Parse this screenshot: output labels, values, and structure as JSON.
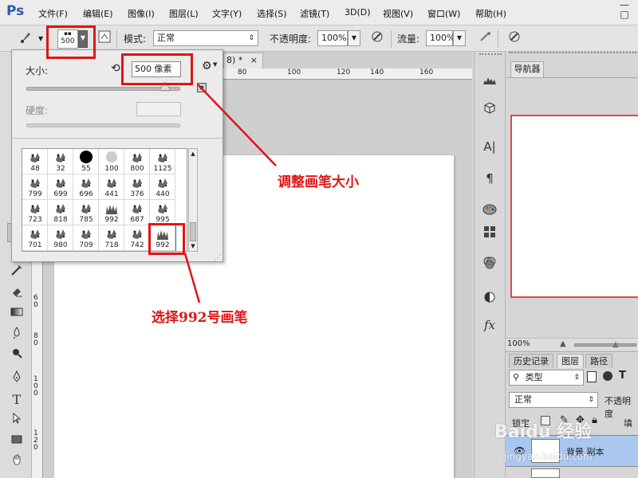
{
  "app": {
    "logo": "Ps"
  },
  "menu": [
    "文件(F)",
    "编辑(E)",
    "图像(I)",
    "图层(L)",
    "文字(Y)",
    "选择(S)",
    "滤镜(T)",
    "3D(D)",
    "视图(V)",
    "窗口(W)",
    "帮助(H)"
  ],
  "window_controls": [
    "—",
    "□"
  ],
  "options": {
    "brush_size": "500",
    "mode_label": "模式:",
    "mode_value": "正常",
    "opacity_label": "不透明度:",
    "opacity_value": "100%",
    "flow_label": "流量:",
    "flow_value": "100%"
  },
  "document": {
    "tab_fragment": "8) *",
    "close": "×",
    "ruler_top": [
      "80",
      "100",
      "120",
      "140",
      "160"
    ],
    "ruler_left": [
      "6\n0",
      "8\n0",
      "1\n0\n0",
      "1\n2\n0"
    ]
  },
  "brush_picker": {
    "size_label": "大小:",
    "size_value": "500 像素",
    "hardness_label": "硬度:",
    "brushes": [
      "48",
      "32",
      "55",
      "100",
      "800",
      "1125",
      "799",
      "699",
      "696",
      "441",
      "376",
      "440",
      "723",
      "818",
      "785",
      "992",
      "687",
      "995",
      "701",
      "980",
      "709",
      "718",
      "742",
      "992"
    ],
    "selected_brush": "992"
  },
  "annotations": {
    "size_note": "调整画笔大小",
    "brush_note": "选择992号画笔"
  },
  "navigator": {
    "tab": "导航器",
    "zoom": "100%"
  },
  "layers": {
    "tabs": [
      "历史记录",
      "图层",
      "路径"
    ],
    "filter_label": "类型",
    "blend_mode": "正常",
    "opacity_label": "不透明度",
    "lock_label": "锁定",
    "fill_label": "填",
    "layer_name": "背景 副本"
  },
  "watermark": {
    "main": "Baidu 经验",
    "sub": "jingyan.baidu.com"
  },
  "colors": {
    "accent_red": "#e01515",
    "ps_blue": "#2f5aa8",
    "layer_selected": "#a9c7ef"
  }
}
